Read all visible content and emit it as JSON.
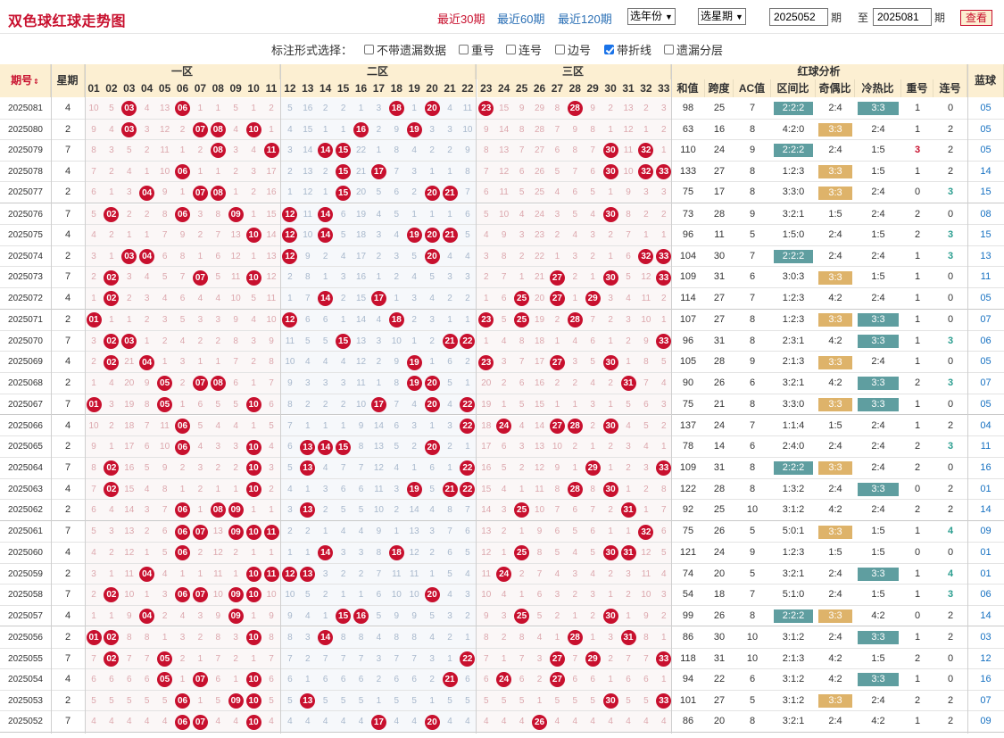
{
  "title": "双色球红球走势图",
  "ranges": [
    {
      "label": "最近30期",
      "active": true
    },
    {
      "label": "最近60期",
      "active": false
    },
    {
      "label": "最近120期",
      "active": false
    }
  ],
  "year_select": "选年份",
  "weekday_select": "选星期",
  "from_issue": "2025052",
  "to_issue": "2025081",
  "label_issue": "期",
  "label_to": "至",
  "query_button": "查看",
  "options_label": "标注形式选择：",
  "options": [
    {
      "label": "不带遗漏数据",
      "checked": false
    },
    {
      "label": "重号",
      "checked": false
    },
    {
      "label": "连号",
      "checked": false
    },
    {
      "label": "边号",
      "checked": false
    },
    {
      "label": "带折线",
      "checked": true
    },
    {
      "label": "遗漏分层",
      "checked": false
    }
  ],
  "headers": {
    "issue": "期号",
    "sort_icon": "sort-updown-icon",
    "weekday": "星期",
    "zone1": "一区",
    "zone2": "二区",
    "zone3": "三区",
    "analysis": "红球分析",
    "blue": "蓝球",
    "sum": "和值",
    "span": "跨度",
    "ac": "AC值",
    "zone_ratio": "区间比",
    "odd_even": "奇偶比",
    "hot_cold": "冷热比",
    "repeat": "重号",
    "consecutive": "连号"
  },
  "numbers": [
    "01",
    "02",
    "03",
    "04",
    "05",
    "06",
    "07",
    "08",
    "09",
    "10",
    "11",
    "12",
    "13",
    "14",
    "15",
    "16",
    "17",
    "18",
    "19",
    "20",
    "21",
    "22",
    "23",
    "24",
    "25",
    "26",
    "27",
    "28",
    "29",
    "30",
    "31",
    "32",
    "33"
  ],
  "colors": {
    "red": "#c8102e",
    "header": "#fcefd2",
    "teal": "#5f9ea0",
    "gold": "#deb36a",
    "blue": "#1570c1"
  },
  "rows": [
    {
      "issue": "2025081",
      "wd": "4",
      "reds": [
        3,
        6,
        18,
        20,
        23,
        28
      ],
      "sum": "98",
      "span": "25",
      "ac": "7",
      "zr": "2:2:2",
      "oe": "2:4",
      "hc": "3:3",
      "rep": "1",
      "con": "0",
      "blue": "05",
      "zr_hl": true,
      "oe_hl": false,
      "hc_hl": true
    },
    {
      "issue": "2025080",
      "wd": "2",
      "reds": [
        3,
        7,
        8,
        10,
        16,
        19
      ],
      "sum": "63",
      "span": "16",
      "ac": "8",
      "zr": "4:2:0",
      "oe": "3:3",
      "hc": "2:4",
      "rep": "1",
      "con": "2",
      "blue": "05",
      "zr_hl": false,
      "oe_hl": true,
      "hc_hl": false
    },
    {
      "issue": "2025079",
      "wd": "7",
      "reds": [
        8,
        11,
        14,
        15,
        30,
        32
      ],
      "sum": "110",
      "span": "24",
      "ac": "9",
      "zr": "2:2:2",
      "oe": "2:4",
      "hc": "1:5",
      "rep": "3",
      "con": "2",
      "blue": "05",
      "zr_hl": true,
      "oe_hl": false,
      "hc_hl": false
    },
    {
      "issue": "2025078",
      "wd": "4",
      "reds": [
        6,
        15,
        17,
        30,
        32,
        33
      ],
      "sum": "133",
      "span": "27",
      "ac": "8",
      "zr": "1:2:3",
      "oe": "3:3",
      "hc": "1:5",
      "rep": "1",
      "con": "2",
      "blue": "14",
      "zr_hl": false,
      "oe_hl": true,
      "hc_hl": false
    },
    {
      "issue": "2025077",
      "wd": "2",
      "reds": [
        4,
        7,
        8,
        15,
        20,
        21
      ],
      "sum": "75",
      "span": "17",
      "ac": "8",
      "zr": "3:3:0",
      "oe": "3:3",
      "hc": "2:4",
      "rep": "0",
      "con": "3",
      "blue": "15",
      "zr_hl": false,
      "oe_hl": true,
      "hc_hl": false
    },
    {
      "issue": "2025076",
      "wd": "7",
      "reds": [
        2,
        6,
        9,
        12,
        14,
        30
      ],
      "sum": "73",
      "span": "28",
      "ac": "9",
      "zr": "3:2:1",
      "oe": "1:5",
      "hc": "2:4",
      "rep": "2",
      "con": "0",
      "blue": "08",
      "zr_hl": false,
      "oe_hl": false,
      "hc_hl": false
    },
    {
      "issue": "2025075",
      "wd": "4",
      "reds": [
        10,
        12,
        14,
        19,
        20,
        21
      ],
      "sum": "96",
      "span": "11",
      "ac": "5",
      "zr": "1:5:0",
      "oe": "2:4",
      "hc": "1:5",
      "rep": "2",
      "con": "3",
      "blue": "15",
      "zr_hl": false,
      "oe_hl": false,
      "hc_hl": false
    },
    {
      "issue": "2025074",
      "wd": "2",
      "reds": [
        3,
        4,
        12,
        20,
        32,
        33
      ],
      "sum": "104",
      "span": "30",
      "ac": "7",
      "zr": "2:2:2",
      "oe": "2:4",
      "hc": "2:4",
      "rep": "1",
      "con": "3",
      "blue": "13",
      "zr_hl": true,
      "oe_hl": false,
      "hc_hl": false
    },
    {
      "issue": "2025073",
      "wd": "7",
      "reds": [
        2,
        7,
        10,
        27,
        30,
        33
      ],
      "sum": "109",
      "span": "31",
      "ac": "6",
      "zr": "3:0:3",
      "oe": "3:3",
      "hc": "1:5",
      "rep": "1",
      "con": "0",
      "blue": "11",
      "zr_hl": false,
      "oe_hl": true,
      "hc_hl": false
    },
    {
      "issue": "2025072",
      "wd": "4",
      "reds": [
        2,
        14,
        17,
        25,
        27,
        29
      ],
      "sum": "114",
      "span": "27",
      "ac": "7",
      "zr": "1:2:3",
      "oe": "4:2",
      "hc": "2:4",
      "rep": "1",
      "con": "0",
      "blue": "05",
      "zr_hl": false,
      "oe_hl": false,
      "hc_hl": false
    },
    {
      "issue": "2025071",
      "wd": "2",
      "reds": [
        1,
        12,
        18,
        23,
        25,
        28
      ],
      "sum": "107",
      "span": "27",
      "ac": "8",
      "zr": "1:2:3",
      "oe": "3:3",
      "hc": "3:3",
      "rep": "1",
      "con": "0",
      "blue": "07",
      "zr_hl": false,
      "oe_hl": true,
      "hc_hl": true
    },
    {
      "issue": "2025070",
      "wd": "7",
      "reds": [
        2,
        3,
        15,
        21,
        22,
        33
      ],
      "sum": "96",
      "span": "31",
      "ac": "8",
      "zr": "2:3:1",
      "oe": "4:2",
      "hc": "3:3",
      "rep": "1",
      "con": "3",
      "blue": "06",
      "zr_hl": false,
      "oe_hl": false,
      "hc_hl": true
    },
    {
      "issue": "2025069",
      "wd": "4",
      "reds": [
        2,
        4,
        19,
        23,
        27,
        30
      ],
      "sum": "105",
      "span": "28",
      "ac": "9",
      "zr": "2:1:3",
      "oe": "3:3",
      "hc": "2:4",
      "rep": "1",
      "con": "0",
      "blue": "05",
      "zr_hl": false,
      "oe_hl": true,
      "hc_hl": false
    },
    {
      "issue": "2025068",
      "wd": "2",
      "reds": [
        5,
        7,
        8,
        19,
        20,
        31
      ],
      "sum": "90",
      "span": "26",
      "ac": "6",
      "zr": "3:2:1",
      "oe": "4:2",
      "hc": "3:3",
      "rep": "2",
      "con": "3",
      "blue": "07",
      "zr_hl": false,
      "oe_hl": false,
      "hc_hl": true
    },
    {
      "issue": "2025067",
      "wd": "7",
      "reds": [
        1,
        5,
        10,
        17,
        20,
        22
      ],
      "sum": "75",
      "span": "21",
      "ac": "8",
      "zr": "3:3:0",
      "oe": "3:3",
      "hc": "3:3",
      "rep": "1",
      "con": "0",
      "blue": "05",
      "zr_hl": false,
      "oe_hl": true,
      "hc_hl": true
    },
    {
      "issue": "2025066",
      "wd": "4",
      "reds": [
        6,
        22,
        24,
        27,
        28,
        30
      ],
      "sum": "137",
      "span": "24",
      "ac": "7",
      "zr": "1:1:4",
      "oe": "1:5",
      "hc": "2:4",
      "rep": "1",
      "con": "2",
      "blue": "04",
      "zr_hl": false,
      "oe_hl": false,
      "hc_hl": false
    },
    {
      "issue": "2025065",
      "wd": "2",
      "reds": [
        6,
        10,
        13,
        14,
        15,
        20
      ],
      "sum": "78",
      "span": "14",
      "ac": "6",
      "zr": "2:4:0",
      "oe": "2:4",
      "hc": "2:4",
      "rep": "2",
      "con": "3",
      "blue": "11",
      "zr_hl": false,
      "oe_hl": false,
      "hc_hl": false
    },
    {
      "issue": "2025064",
      "wd": "7",
      "reds": [
        2,
        10,
        13,
        22,
        29,
        33
      ],
      "sum": "109",
      "span": "31",
      "ac": "8",
      "zr": "2:2:2",
      "oe": "3:3",
      "hc": "2:4",
      "rep": "2",
      "con": "0",
      "blue": "16",
      "zr_hl": true,
      "oe_hl": true,
      "hc_hl": false
    },
    {
      "issue": "2025063",
      "wd": "4",
      "reds": [
        2,
        10,
        19,
        21,
        22,
        28,
        30
      ],
      "sum": "122",
      "span": "28",
      "ac": "8",
      "zr": "1:3:2",
      "oe": "2:4",
      "hc": "3:3",
      "rep": "0",
      "con": "2",
      "blue": "01",
      "zr_hl": false,
      "oe_hl": false,
      "hc_hl": true
    },
    {
      "issue": "2025062",
      "wd": "2",
      "reds": [
        6,
        8,
        9,
        13,
        25,
        31
      ],
      "sum": "92",
      "span": "25",
      "ac": "10",
      "zr": "3:1:2",
      "oe": "4:2",
      "hc": "2:4",
      "rep": "2",
      "con": "2",
      "blue": "14",
      "zr_hl": false,
      "oe_hl": false,
      "hc_hl": false
    },
    {
      "issue": "2025061",
      "wd": "7",
      "reds": [
        6,
        7,
        9,
        10,
        11,
        32
      ],
      "sum": "75",
      "span": "26",
      "ac": "5",
      "zr": "5:0:1",
      "oe": "3:3",
      "hc": "1:5",
      "rep": "1",
      "con": "4",
      "blue": "09",
      "zr_hl": false,
      "oe_hl": true,
      "hc_hl": false
    },
    {
      "issue": "2025060",
      "wd": "4",
      "reds": [
        6,
        14,
        18,
        25,
        30,
        31
      ],
      "sum": "121",
      "span": "24",
      "ac": "9",
      "zr": "1:2:3",
      "oe": "1:5",
      "hc": "1:5",
      "rep": "0",
      "con": "0",
      "blue": "01",
      "zr_hl": false,
      "oe_hl": false,
      "hc_hl": false
    },
    {
      "issue": "2025059",
      "wd": "2",
      "reds": [
        4,
        10,
        11,
        12,
        13,
        24
      ],
      "sum": "74",
      "span": "20",
      "ac": "5",
      "zr": "3:2:1",
      "oe": "2:4",
      "hc": "3:3",
      "rep": "1",
      "con": "4",
      "blue": "01",
      "zr_hl": false,
      "oe_hl": false,
      "hc_hl": true
    },
    {
      "issue": "2025058",
      "wd": "7",
      "reds": [
        2,
        6,
        7,
        9,
        10,
        20
      ],
      "sum": "54",
      "span": "18",
      "ac": "7",
      "zr": "5:1:0",
      "oe": "2:4",
      "hc": "1:5",
      "rep": "1",
      "con": "3",
      "blue": "06",
      "zr_hl": false,
      "oe_hl": false,
      "hc_hl": false
    },
    {
      "issue": "2025057",
      "wd": "4",
      "reds": [
        4,
        9,
        15,
        16,
        25,
        30
      ],
      "sum": "99",
      "span": "26",
      "ac": "8",
      "zr": "2:2:2",
      "oe": "3:3",
      "hc": "4:2",
      "rep": "0",
      "con": "2",
      "blue": "14",
      "zr_hl": true,
      "oe_hl": true,
      "hc_hl": false
    },
    {
      "issue": "2025056",
      "wd": "2",
      "reds": [
        1,
        2,
        10,
        14,
        28,
        31
      ],
      "sum": "86",
      "span": "30",
      "ac": "10",
      "zr": "3:1:2",
      "oe": "2:4",
      "hc": "3:3",
      "rep": "1",
      "con": "2",
      "blue": "03",
      "zr_hl": false,
      "oe_hl": false,
      "hc_hl": true
    },
    {
      "issue": "2025055",
      "wd": "7",
      "reds": [
        2,
        5,
        22,
        27,
        29,
        33
      ],
      "sum": "118",
      "span": "31",
      "ac": "10",
      "zr": "2:1:3",
      "oe": "4:2",
      "hc": "1:5",
      "rep": "2",
      "con": "0",
      "blue": "12",
      "zr_hl": false,
      "oe_hl": false,
      "hc_hl": false
    },
    {
      "issue": "2025054",
      "wd": "4",
      "reds": [
        5,
        7,
        10,
        21,
        24,
        27
      ],
      "sum": "94",
      "span": "22",
      "ac": "6",
      "zr": "3:1:2",
      "oe": "4:2",
      "hc": "3:3",
      "rep": "1",
      "con": "0",
      "blue": "16",
      "zr_hl": false,
      "oe_hl": false,
      "hc_hl": true
    },
    {
      "issue": "2025053",
      "wd": "2",
      "reds": [
        6,
        9,
        10,
        13,
        30,
        33
      ],
      "sum": "101",
      "span": "27",
      "ac": "5",
      "zr": "3:1:2",
      "oe": "3:3",
      "hc": "2:4",
      "rep": "2",
      "con": "2",
      "blue": "07",
      "zr_hl": false,
      "oe_hl": true,
      "hc_hl": false
    },
    {
      "issue": "2025052",
      "wd": "7",
      "reds": [
        6,
        7,
        10,
        17,
        20,
        26
      ],
      "sum": "86",
      "span": "20",
      "ac": "8",
      "zr": "3:2:1",
      "oe": "2:4",
      "hc": "4:2",
      "rep": "1",
      "con": "2",
      "blue": "09",
      "zr_hl": false,
      "oe_hl": false,
      "hc_hl": false
    }
  ]
}
